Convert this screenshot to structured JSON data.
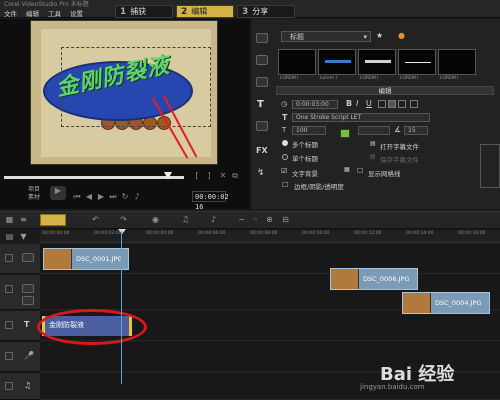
{
  "app": {
    "title": "Corel VideoStudio Pro",
    "suffix": "未标题"
  },
  "menu": [
    "文件",
    "编辑",
    "工具",
    "设置"
  ],
  "steps": [
    {
      "num": "1",
      "label": "捕获",
      "active": false
    },
    {
      "num": "2",
      "label": "编辑",
      "active": true
    },
    {
      "num": "3",
      "label": "分享",
      "active": false
    }
  ],
  "preview": {
    "overlay_text": "金刚防裂液",
    "timecode": "00:00:02 16",
    "mode_labels": [
      "项目",
      "素材"
    ],
    "scrub_fraction": 0.9
  },
  "library": {
    "category": "标题",
    "thumbnails": [
      "LOREM I",
      "Lorem I",
      "LOREM I",
      "LOREM I",
      "LOREM I"
    ]
  },
  "options": {
    "header": "编辑",
    "duration": "0:00:03:00",
    "font": "One Stroke Script LET",
    "font_size": "100",
    "line_spacing": "15",
    "rotation": "0",
    "multi_title": "多个标题",
    "single_title": "单个标题",
    "text_bg": "文字背景",
    "open_subtitle": "打开字幕文件",
    "save_subtitle": "保存字幕文件",
    "show_grid": "显示网格线",
    "border_shadow": "边框/阴影/透明度"
  },
  "timeline": {
    "ruler_ticks": [
      "00:00:00:00",
      "00:00:02:00",
      "00:00:04:00",
      "00:00:06:00",
      "00:00:08:00",
      "00:00:10:00",
      "00:00:12:00",
      "00:00:14:00",
      "00:00:16:00"
    ],
    "clips": [
      {
        "track": 0,
        "label": "DSC_0001.JPG"
      },
      {
        "track": 1,
        "label": "DSC_0006.JPG"
      },
      {
        "track": 2,
        "label": "DSC_0004.JPG"
      }
    ],
    "title_clip": "金刚防裂液"
  },
  "watermark": {
    "brand": "Bai 经验",
    "url": "jingyan.baidu.com"
  },
  "colors": {
    "accent": "#d4b347",
    "clip": "#7b9ab5",
    "title_clip": "#4b5fa0",
    "annotation": "#d61a1a",
    "overlay_text": "#5fd36a"
  }
}
